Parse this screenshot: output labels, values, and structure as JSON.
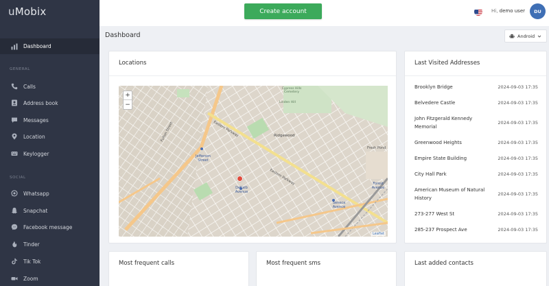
{
  "app": {
    "logo_u": "u",
    "logo_rest": "Mobix"
  },
  "sidebar": {
    "dashboard": "Dashboard",
    "section_general": "GENERAL",
    "section_social": "SOCIAL",
    "general_items": [
      {
        "label": "Calls",
        "icon": "phone-icon"
      },
      {
        "label": "Address book",
        "icon": "contact-book-icon"
      },
      {
        "label": "Messages",
        "icon": "message-icon"
      },
      {
        "label": "Location",
        "icon": "location-pin-icon"
      },
      {
        "label": "Keylogger",
        "icon": "keyboard-icon"
      }
    ],
    "social_items": [
      {
        "label": "Whatsapp",
        "icon": "whatsapp-icon"
      },
      {
        "label": "Snapchat",
        "icon": "snapchat-icon"
      },
      {
        "label": "Facebook message",
        "icon": "messenger-icon"
      },
      {
        "label": "Tinder",
        "icon": "tinder-icon"
      },
      {
        "label": "Tik Tok",
        "icon": "tiktok-icon"
      },
      {
        "label": "Zoom",
        "icon": "zoom-icon"
      }
    ]
  },
  "topbar": {
    "create_account": "Create account",
    "greeting_hi": "Hi,",
    "user_name": "demo user",
    "avatar_initials": "DU"
  },
  "page": {
    "title": "Dashboard",
    "device": "Android"
  },
  "locations": {
    "title": "Locations",
    "zoom_in": "+",
    "zoom_out": "−",
    "attribution": "Leaflet",
    "map_labels": {
      "fulton": "Fulton Street",
      "eastern1": "Eastern Parkway",
      "eastern2": "Eastern Parkway",
      "ridgewood": "Ridgewood",
      "jefferson": "Jefferson Street",
      "dekalb": "DeKalb Avenue",
      "seneca": "Seneca Avenue",
      "forest": "Forest Avenue",
      "cemetery": "Cypress Hills Cemetery",
      "linden": "Linden Hill",
      "fresh": "Fresh Pond"
    }
  },
  "last_visited": {
    "title": "Last Visited Addresses",
    "rows": [
      {
        "name": "Brooklyn Bridge",
        "time": "2024-09-03 17:35"
      },
      {
        "name": "Belvedere Castle",
        "time": "2024-09-03 17:35"
      },
      {
        "name": "John Fitzgerald Kennedy Memorial",
        "time": "2024-09-03 17:35"
      },
      {
        "name": "Greenwood Heights",
        "time": "2024-09-03 17:35"
      },
      {
        "name": "Empire State Building",
        "time": "2024-09-03 17:35"
      },
      {
        "name": "City Hall Park",
        "time": "2024-09-03 17:35"
      },
      {
        "name": "American Museum of Natural History",
        "time": "2024-09-03 17:35"
      },
      {
        "name": "273-277 West St",
        "time": "2024-09-03 17:35"
      },
      {
        "name": "285-237 Prospect Ave",
        "time": "2024-09-03 17:35"
      }
    ]
  },
  "bottom_cards": {
    "calls": "Most frequent calls",
    "sms": "Most frequent sms",
    "contacts": "Last added contacts"
  },
  "colors": {
    "sidebar_bg": "#2f3545",
    "accent_green": "#3caa5b",
    "avatar_blue": "#3f6fb5"
  }
}
